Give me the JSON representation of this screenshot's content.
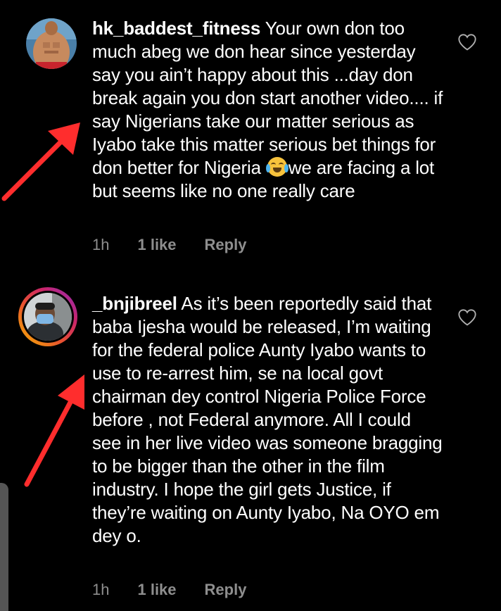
{
  "comments": [
    {
      "username": "hk_baddest_fitness",
      "text_before_emoji": "Your own don too much abeg we don hear since yesterday say you ain’t happy about this ...day don break again you don start another video.... if say Nigerians take our matter serious as Iyabo take this matter serious bet things for don better for Nigeria ",
      "emoji": "face-with-tears-of-joy",
      "text_after_emoji": "we are facing a lot but seems like no one really care",
      "time": "1h",
      "likes": "1 like",
      "reply": "Reply"
    },
    {
      "username": "_bnjibreel",
      "text_before_emoji": "As it’s been reportedly said that baba Ijesha would be released, I’m waiting for the federal police Aunty Iyabo wants to use to re-arrest him, se na local govt chairman dey control Nigeria Police Force before , not Federal anymore. All I could see in her live video was someone bragging to be bigger than the other in the film industry. I hope the girl gets  Justice, if they’re waiting on Aunty Iyabo, Na OYO em dey o.",
      "time": "1h",
      "likes": "1 like",
      "reply": "Reply"
    }
  ],
  "colors": {
    "background": "#000000",
    "meta": "#8e8e8e",
    "annotation_arrow": "#ff2d2d"
  },
  "icons": [
    "heart-outline-icon",
    "annotation-arrow-icon"
  ]
}
